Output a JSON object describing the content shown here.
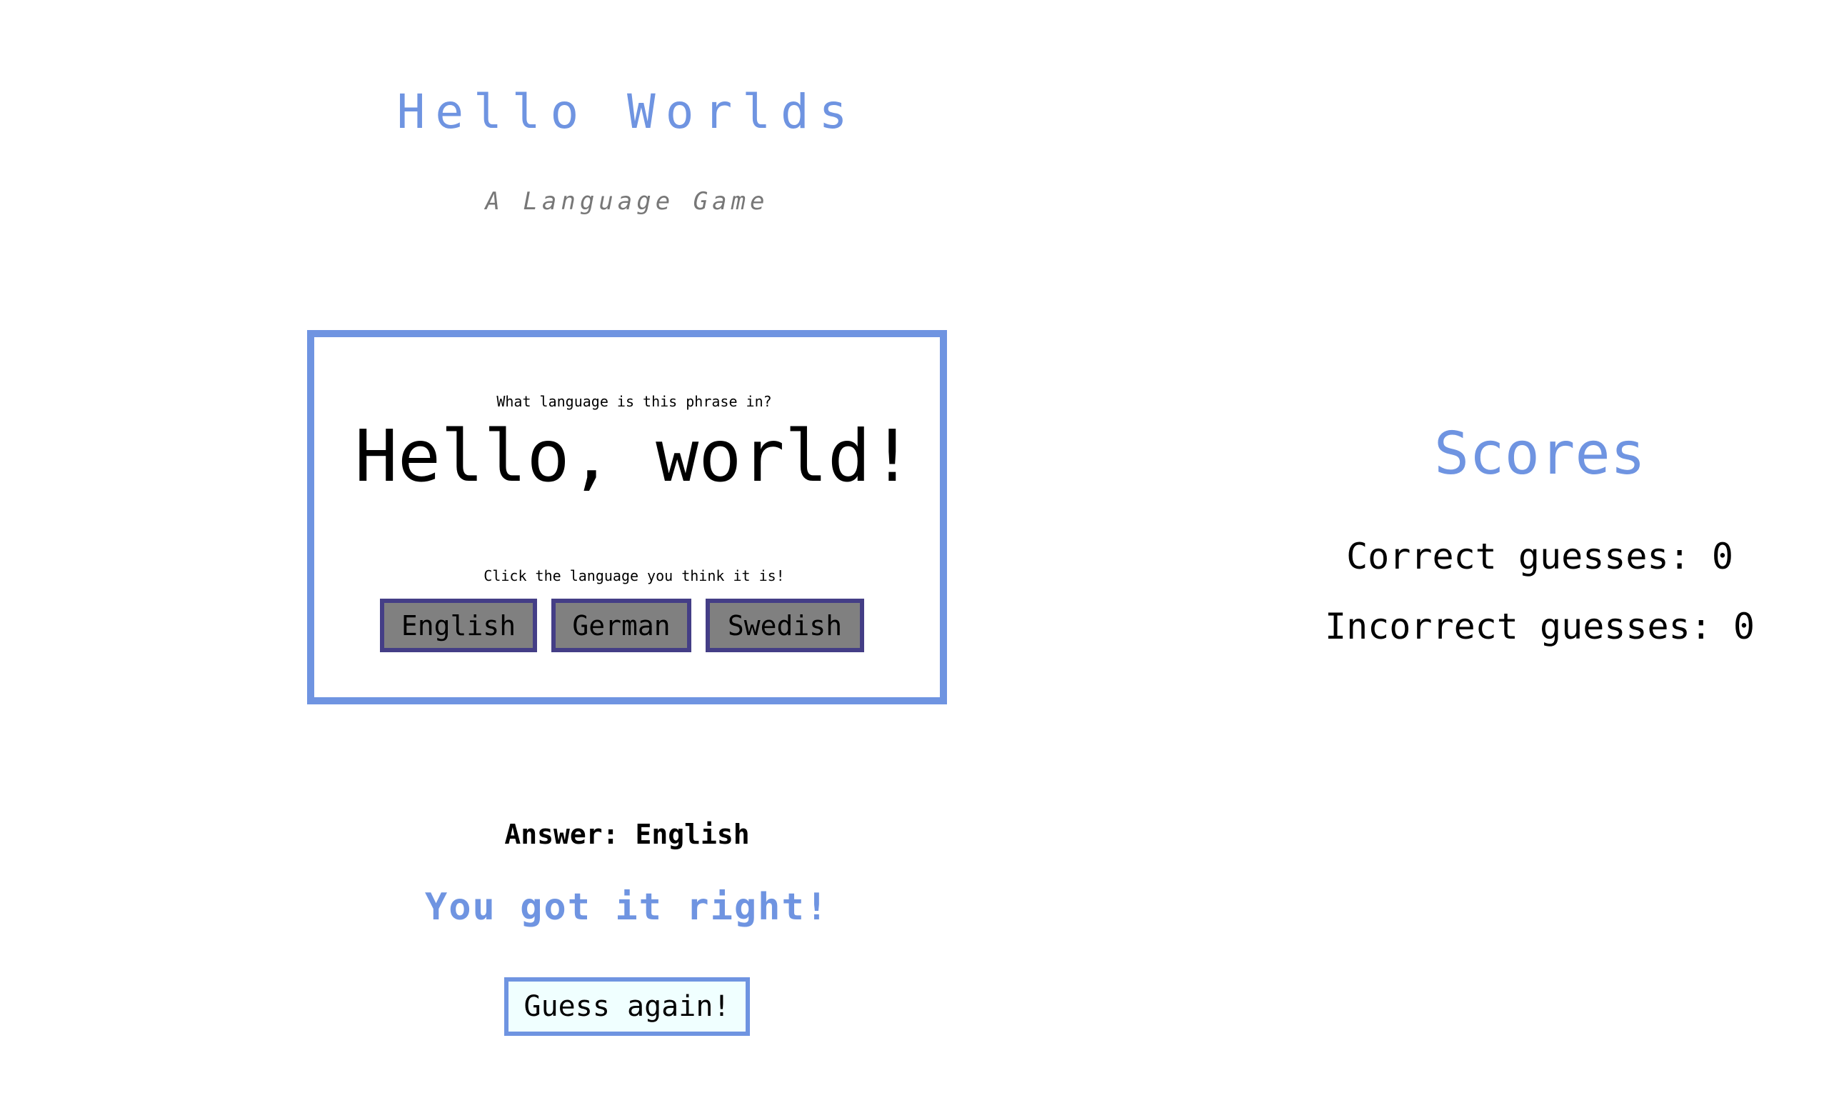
{
  "header": {
    "title": "Hello Worlds",
    "subtitle": "A Language Game"
  },
  "game": {
    "question": "What language is this phrase in?",
    "phrase": "Hello, world!",
    "instruction": "Click the language you think it is!",
    "choices": [
      {
        "label": "English"
      },
      {
        "label": "German"
      },
      {
        "label": "Swedish"
      }
    ]
  },
  "result": {
    "answer_text": "Answer: English",
    "message": "You got it right!",
    "guess_again_label": "Guess again!"
  },
  "scores": {
    "title": "Scores",
    "correct_text": "Correct guesses: 0",
    "incorrect_text": "Incorrect guesses: 0",
    "correct": 0,
    "incorrect": 0
  },
  "colors": {
    "accent": "#6f94e1",
    "button_border": "#443e86",
    "button_bg": "#808080",
    "guess_again_bg": "#f0ffff",
    "subtitle": "#777777"
  }
}
